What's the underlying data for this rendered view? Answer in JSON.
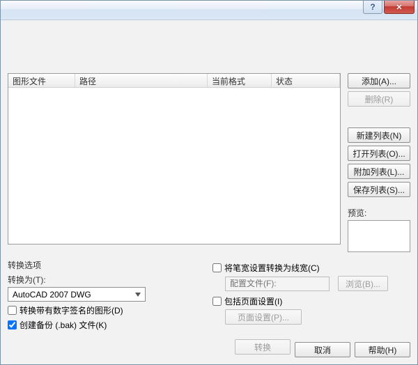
{
  "titlebar": {
    "help_glyph": "?",
    "close_glyph": "✕"
  },
  "list": {
    "col_file": "图形文件",
    "col_path": "路径",
    "col_format": "当前格式",
    "col_state": "状态"
  },
  "sidebar": {
    "add": "添加(A)...",
    "remove": "删除(R)",
    "new_list": "新建列表(N)",
    "open_list": "打开列表(O)...",
    "append_list": "附加列表(L)...",
    "save_list": "保存列表(S)...",
    "preview_label": "预览:"
  },
  "options": {
    "group_title": "转换选项",
    "convert_to_label": "转换为(T):",
    "convert_to_value": "AutoCAD 2007 DWG",
    "convert_signed": "转换带有数字签名的图形(D)",
    "create_backup": "创建备份 (.bak) 文件(K)",
    "penwidth_to_lineweight": "将笔宽设置转换为线宽(C)",
    "config_file_label": "配置文件(F):",
    "browse1": "浏览(B)...",
    "include_page_setup": "包括页面设置(I)",
    "page_setup_btn": "页面设置(P)..."
  },
  "footer": {
    "convert": "转换",
    "cancel": "取消",
    "help": "帮助(H)"
  }
}
